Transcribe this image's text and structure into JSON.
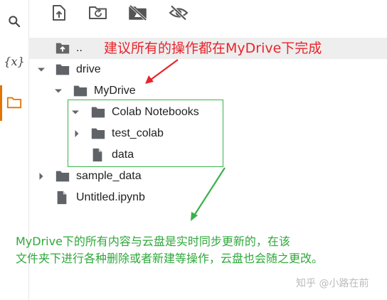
{
  "rail": {
    "variables_glyph": "{x}",
    "items": [
      {
        "icon": "search-icon"
      },
      {
        "icon": "variables-icon"
      },
      {
        "icon": "folder-icon",
        "active": true
      }
    ],
    "active_color": "#e37400"
  },
  "toolbar": {
    "buttons": [
      {
        "icon": "upload-icon"
      },
      {
        "icon": "refresh-folder-icon"
      },
      {
        "icon": "unmount-drive-icon"
      },
      {
        "icon": "hide-files-icon"
      }
    ]
  },
  "tree": {
    "parent": "..",
    "drive": "drive",
    "mydrive": "MyDrive",
    "colab_notebooks": "Colab Notebooks",
    "test_colab": "test_colab",
    "data_file": "data",
    "sample_data": "sample_data",
    "untitled": "Untitled.ipynb"
  },
  "annotations": {
    "red_callout": "建议所有的操作都在MyDrive下完成",
    "green_line1": "MyDrive下的所有内容与云盘是实时同步更新的，在该",
    "green_line2": "文件夹下进行各种删除或者新建等操作，云盘也会随之更改。",
    "red_color": "#e8242c",
    "green_color": "#2fa83a"
  },
  "watermark": "知乎 @小路在前"
}
